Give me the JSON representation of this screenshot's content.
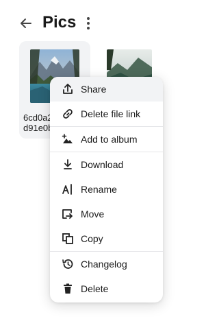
{
  "header": {
    "title": "Pics"
  },
  "files": [
    {
      "name_line1": "6cd0a2",
      "name_line2": "d91e0b"
    }
  ],
  "menu": {
    "items": [
      {
        "label": "Share",
        "icon": "share-icon"
      },
      {
        "label": "Delete file link",
        "icon": "link-icon"
      },
      {
        "label": "Add to album",
        "icon": "add-to-album-icon"
      },
      {
        "label": "Download",
        "icon": "download-icon"
      },
      {
        "label": "Rename",
        "icon": "rename-icon"
      },
      {
        "label": "Move",
        "icon": "move-icon"
      },
      {
        "label": "Copy",
        "icon": "copy-icon"
      },
      {
        "label": "Changelog",
        "icon": "history-icon"
      },
      {
        "label": "Delete",
        "icon": "trash-icon"
      }
    ]
  },
  "colors": {
    "text": "#1a1a1a",
    "hover_bg": "#f2f3f5",
    "divider": "#e4e5e8"
  }
}
